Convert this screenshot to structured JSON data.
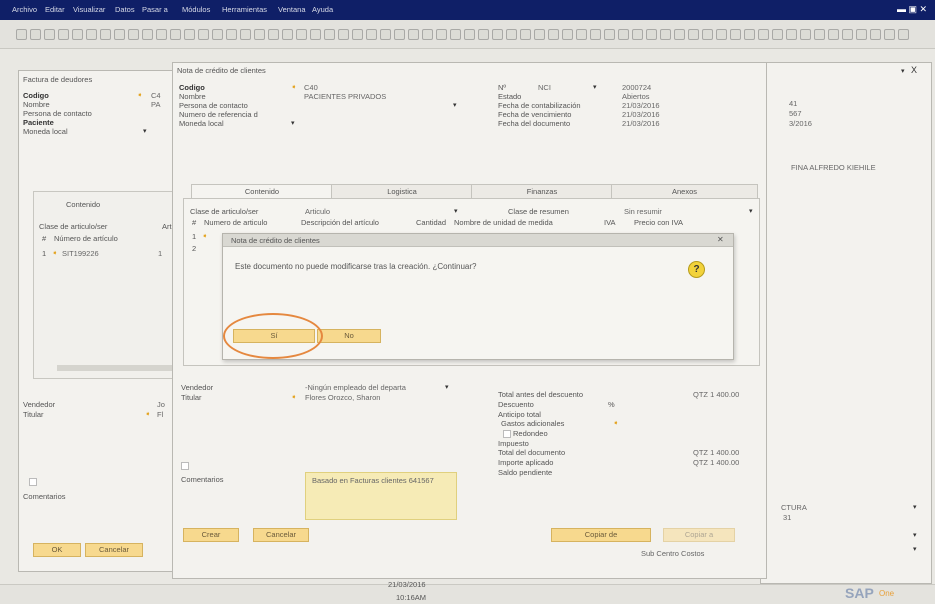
{
  "menu": {
    "items": [
      "Archivo",
      "Editar",
      "Visualizar",
      "Datos",
      "Pasar a",
      "Módulos",
      "Herramientas",
      "Ventana",
      "Ayuda"
    ]
  },
  "left_window": {
    "title": "Factura de deudores",
    "codigo_label": "Codigo",
    "codigo_value": "C4",
    "nombre_label": "Nombre",
    "nombre_value": "PA",
    "contacto_label": "Persona de contacto",
    "paciente_label": "Paciente",
    "moneda_label": "Moneda local",
    "tab_contenido": "Contenido",
    "clase_label": "Clase de articulo/ser",
    "art_col": "Art",
    "num_articulo_col": "Número de artículo",
    "row_index": "1",
    "row_item": "SIT199226",
    "row_qty": "1",
    "vendedor_label": "Vendedor",
    "vendedor_value": "Jo",
    "titular_label": "Titular",
    "titular_value": "Fl",
    "comentarios_label": "Comentarios",
    "ok_button": "OK",
    "cancelar_button": "Cancelar"
  },
  "right_window": {
    "value1": "41",
    "value2": "567",
    "value3": "3/2016",
    "name": "FINA ALFREDO KIEHILE",
    "tura": "CTURA",
    "v31": "31",
    "centro": "Sub Centro Costos",
    "x_close": "X"
  },
  "nota": {
    "title": "Nota de crédito de clientes",
    "codigo_label": "Codigo",
    "codigo_value": "C40",
    "nombre_label": "Nombre",
    "nombre_value": "PACIENTES PRIVADOS",
    "contacto_label": "Persona de contacto",
    "referencia_label": "Numero de referencia d",
    "moneda_label": "Moneda local",
    "nr_label": "Nº",
    "nr_series": "NCI",
    "nr_value": "2000724",
    "estado_label": "Estado",
    "estado_value": "Abiertos",
    "fecha_cont_label": "Fecha de contabilización",
    "fecha_cont_value": "21/03/2016",
    "fecha_venc_label": "Fecha de vencimiento",
    "fecha_venc_value": "21/03/2016",
    "fecha_doc_label": "Fecha del documento",
    "fecha_doc_value": "21/03/2016",
    "tabs": [
      "Contenido",
      "Logistica",
      "Finanzas",
      "Anexos"
    ],
    "clase_label": "Clase de articulo/ser",
    "clase_value": "Articulo",
    "resumen_label": "Clase de resumen",
    "resumen_value": "Sin resumir",
    "columns": [
      "#",
      "Numero de articulo",
      "Descripción del artículo",
      "Cantidad",
      "Nombre de unidad de medida",
      "IVA",
      "Precio con IVA"
    ],
    "row1": "1",
    "row2": "2",
    "vendedor_label": "Vendedor",
    "vendedor_value": "-Ningún empleado del departa",
    "titular_label": "Titular",
    "titular_value": "Flores Orozco, Sharon",
    "total_antes_label": "Total antes del descuento",
    "total_antes_value": "QTZ 1 400.00",
    "descuento_label": "Descuento",
    "pct": "%",
    "anticipo_label": "Anticipo total",
    "gastos_label": "Gastos adicionales",
    "redondeo_label": "Redondeo",
    "impuesto_label": "Impuesto",
    "total_doc_label": "Total del documento",
    "total_doc_value": "QTZ 1 400.00",
    "importe_label": "Importe aplicado",
    "importe_value": "QTZ 1 400.00",
    "saldo_label": "Saldo pendiente",
    "comentarios_label": "Comentarios",
    "comentarios_value": "Basado en Facturas clientes 641567",
    "crear_button": "Crear",
    "cancelar_button": "Cancelar",
    "copiar_button": "Copiar de",
    "copiar2_button": "Copiar a"
  },
  "dialog": {
    "title": "Nota de crédito de clientes",
    "message": "Este documento no puede modificarse tras la creación. ¿Continuar?",
    "si_button": "Sí",
    "no_button": "No"
  },
  "status": {
    "date": "21/03/2016",
    "time": "10:16AM",
    "brand": "SAP",
    "brand_suffix": "One"
  },
  "colors": {
    "menubar": "#0f1f67",
    "button_fill": "#f7d98e",
    "highlight_circle": "#e5883f",
    "accent_arrow": "#e4a31f"
  }
}
